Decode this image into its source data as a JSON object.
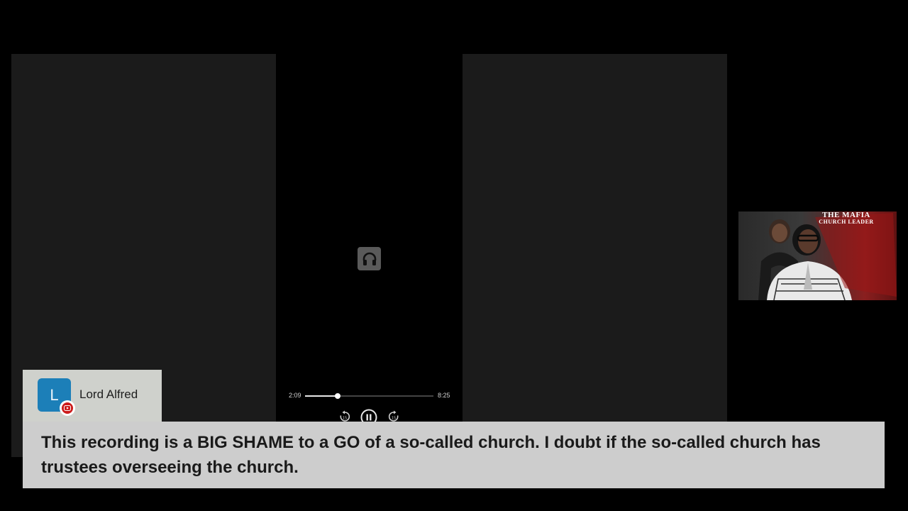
{
  "player": {
    "elapsed": "2:09",
    "total": "8:25",
    "progress_fraction": 0.256,
    "icon_center": "headphones-icon",
    "controls": {
      "rewind_icon": "rewind-icon",
      "pause_icon": "pause-icon",
      "forward_icon": "fast-forward-icon"
    }
  },
  "webcam": {
    "book_title_line1": "THE MAFIA",
    "book_title_line2": "CHURCH LEADER"
  },
  "comment": {
    "avatar_letter": "L",
    "user_name": "Lord Alfred",
    "platform_icon": "youtube-icon",
    "text": "This recording is a BIG SHAME to a GO of a so-called church. I doubt if the so-called church has trustees overseeing the church."
  },
  "colors": {
    "avatar_bg": "#1c7fb8",
    "youtube_red": "#cc1b1b",
    "caption_bg": "#cdcdcd",
    "panel_bg": "#1b1b1b"
  }
}
